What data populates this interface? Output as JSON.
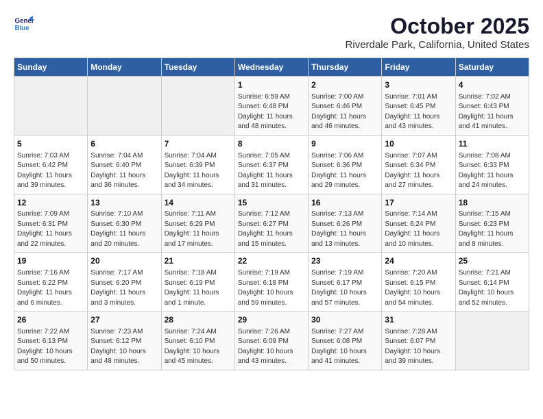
{
  "logo": {
    "line1": "General",
    "line2": "Blue"
  },
  "title": "October 2025",
  "location": "Riverdale Park, California, United States",
  "weekdays": [
    "Sunday",
    "Monday",
    "Tuesday",
    "Wednesday",
    "Thursday",
    "Friday",
    "Saturday"
  ],
  "weeks": [
    [
      {
        "day": "",
        "info": ""
      },
      {
        "day": "",
        "info": ""
      },
      {
        "day": "",
        "info": ""
      },
      {
        "day": "1",
        "info": "Sunrise: 6:59 AM\nSunset: 6:48 PM\nDaylight: 11 hours\nand 48 minutes."
      },
      {
        "day": "2",
        "info": "Sunrise: 7:00 AM\nSunset: 6:46 PM\nDaylight: 11 hours\nand 46 minutes."
      },
      {
        "day": "3",
        "info": "Sunrise: 7:01 AM\nSunset: 6:45 PM\nDaylight: 11 hours\nand 43 minutes."
      },
      {
        "day": "4",
        "info": "Sunrise: 7:02 AM\nSunset: 6:43 PM\nDaylight: 11 hours\nand 41 minutes."
      }
    ],
    [
      {
        "day": "5",
        "info": "Sunrise: 7:03 AM\nSunset: 6:42 PM\nDaylight: 11 hours\nand 39 minutes."
      },
      {
        "day": "6",
        "info": "Sunrise: 7:04 AM\nSunset: 6:40 PM\nDaylight: 11 hours\nand 36 minutes."
      },
      {
        "day": "7",
        "info": "Sunrise: 7:04 AM\nSunset: 6:39 PM\nDaylight: 11 hours\nand 34 minutes."
      },
      {
        "day": "8",
        "info": "Sunrise: 7:05 AM\nSunset: 6:37 PM\nDaylight: 11 hours\nand 31 minutes."
      },
      {
        "day": "9",
        "info": "Sunrise: 7:06 AM\nSunset: 6:36 PM\nDaylight: 11 hours\nand 29 minutes."
      },
      {
        "day": "10",
        "info": "Sunrise: 7:07 AM\nSunset: 6:34 PM\nDaylight: 11 hours\nand 27 minutes."
      },
      {
        "day": "11",
        "info": "Sunrise: 7:08 AM\nSunset: 6:33 PM\nDaylight: 11 hours\nand 24 minutes."
      }
    ],
    [
      {
        "day": "12",
        "info": "Sunrise: 7:09 AM\nSunset: 6:31 PM\nDaylight: 11 hours\nand 22 minutes."
      },
      {
        "day": "13",
        "info": "Sunrise: 7:10 AM\nSunset: 6:30 PM\nDaylight: 11 hours\nand 20 minutes."
      },
      {
        "day": "14",
        "info": "Sunrise: 7:11 AM\nSunset: 6:29 PM\nDaylight: 11 hours\nand 17 minutes."
      },
      {
        "day": "15",
        "info": "Sunrise: 7:12 AM\nSunset: 6:27 PM\nDaylight: 11 hours\nand 15 minutes."
      },
      {
        "day": "16",
        "info": "Sunrise: 7:13 AM\nSunset: 6:26 PM\nDaylight: 11 hours\nand 13 minutes."
      },
      {
        "day": "17",
        "info": "Sunrise: 7:14 AM\nSunset: 6:24 PM\nDaylight: 11 hours\nand 10 minutes."
      },
      {
        "day": "18",
        "info": "Sunrise: 7:15 AM\nSunset: 6:23 PM\nDaylight: 11 hours\nand 8 minutes."
      }
    ],
    [
      {
        "day": "19",
        "info": "Sunrise: 7:16 AM\nSunset: 6:22 PM\nDaylight: 11 hours\nand 6 minutes."
      },
      {
        "day": "20",
        "info": "Sunrise: 7:17 AM\nSunset: 6:20 PM\nDaylight: 11 hours\nand 3 minutes."
      },
      {
        "day": "21",
        "info": "Sunrise: 7:18 AM\nSunset: 6:19 PM\nDaylight: 11 hours\nand 1 minute."
      },
      {
        "day": "22",
        "info": "Sunrise: 7:19 AM\nSunset: 6:18 PM\nDaylight: 10 hours\nand 59 minutes."
      },
      {
        "day": "23",
        "info": "Sunrise: 7:19 AM\nSunset: 6:17 PM\nDaylight: 10 hours\nand 57 minutes."
      },
      {
        "day": "24",
        "info": "Sunrise: 7:20 AM\nSunset: 6:15 PM\nDaylight: 10 hours\nand 54 minutes."
      },
      {
        "day": "25",
        "info": "Sunrise: 7:21 AM\nSunset: 6:14 PM\nDaylight: 10 hours\nand 52 minutes."
      }
    ],
    [
      {
        "day": "26",
        "info": "Sunrise: 7:22 AM\nSunset: 6:13 PM\nDaylight: 10 hours\nand 50 minutes."
      },
      {
        "day": "27",
        "info": "Sunrise: 7:23 AM\nSunset: 6:12 PM\nDaylight: 10 hours\nand 48 minutes."
      },
      {
        "day": "28",
        "info": "Sunrise: 7:24 AM\nSunset: 6:10 PM\nDaylight: 10 hours\nand 45 minutes."
      },
      {
        "day": "29",
        "info": "Sunrise: 7:26 AM\nSunset: 6:09 PM\nDaylight: 10 hours\nand 43 minutes."
      },
      {
        "day": "30",
        "info": "Sunrise: 7:27 AM\nSunset: 6:08 PM\nDaylight: 10 hours\nand 41 minutes."
      },
      {
        "day": "31",
        "info": "Sunrise: 7:28 AM\nSunset: 6:07 PM\nDaylight: 10 hours\nand 39 minutes."
      },
      {
        "day": "",
        "info": ""
      }
    ]
  ]
}
